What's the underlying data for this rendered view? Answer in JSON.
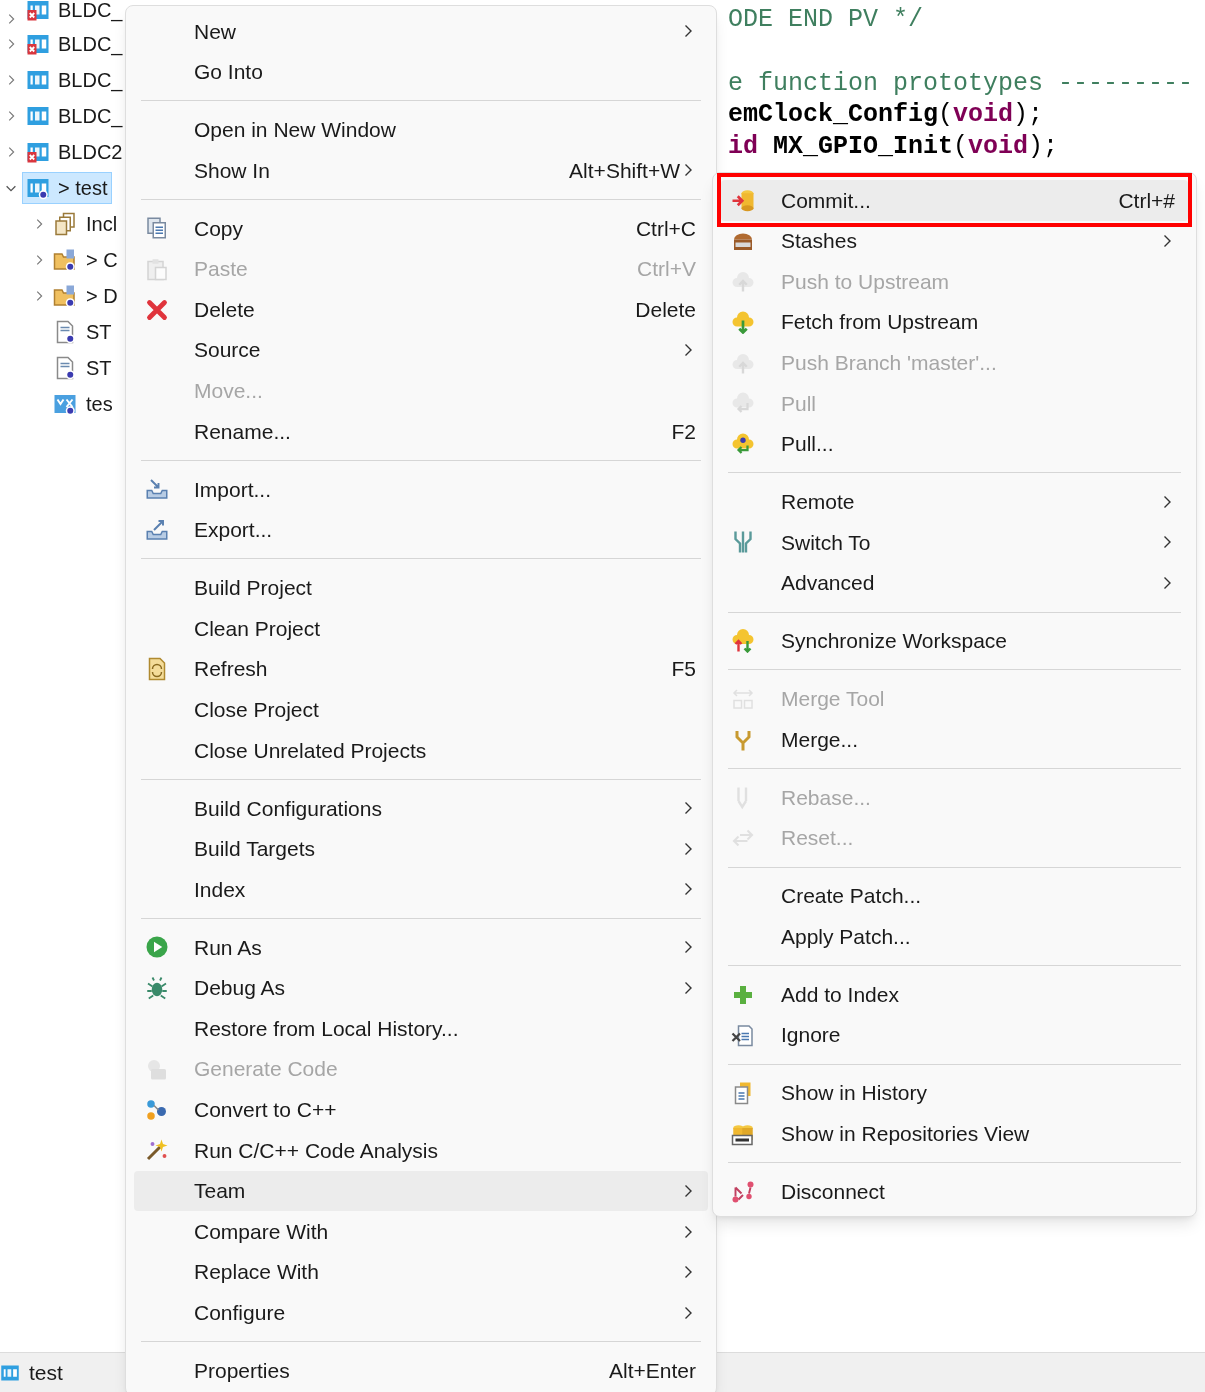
{
  "project_tree": [
    {
      "label": "BLDC_",
      "kind": "project",
      "error": true,
      "expanded": false,
      "selected": false
    },
    {
      "label": "BLDC_",
      "kind": "project",
      "error": true,
      "expanded": false,
      "selected": false
    },
    {
      "label": "BLDC_",
      "kind": "project",
      "error": false,
      "expanded": false,
      "selected": false
    },
    {
      "label": "BLDC_",
      "kind": "project",
      "error": false,
      "expanded": false,
      "selected": false
    },
    {
      "label": "BLDC2",
      "kind": "project",
      "error": true,
      "expanded": false,
      "selected": false
    },
    {
      "label": "> test",
      "kind": "project-untracked",
      "error": false,
      "expanded": true,
      "selected": true,
      "children": [
        {
          "label": "Incl",
          "kind": "includes",
          "expandable": true
        },
        {
          "label": "> C",
          "kind": "folder",
          "expandable": true
        },
        {
          "label": "> D",
          "kind": "folder",
          "expandable": true
        },
        {
          "label": "ST",
          "kind": "file",
          "expandable": false
        },
        {
          "label": "ST",
          "kind": "file",
          "expandable": false
        },
        {
          "label": "tes",
          "kind": "mx",
          "expandable": false
        }
      ]
    }
  ],
  "editor": {
    "lines": [
      {
        "segments": [
          {
            "text": "ODE END PV */",
            "kind": "comment"
          }
        ]
      },
      {
        "segments": [
          {
            "text": "e function prototypes ---------",
            "kind": "comment"
          }
        ]
      },
      {
        "segments": [
          {
            "text": "emClock_Config",
            "kind": "name"
          },
          {
            "text": "(",
            "kind": "plain"
          },
          {
            "text": "void",
            "kind": "keyword"
          },
          {
            "text": ");",
            "kind": "plain"
          }
        ]
      },
      {
        "segments": [
          {
            "text": "id",
            "kind": "keyword"
          },
          {
            "text": " MX_GPIO_Init",
            "kind": "name"
          },
          {
            "text": "(",
            "kind": "plain"
          },
          {
            "text": "void",
            "kind": "keyword"
          },
          {
            "text": ");",
            "kind": "plain"
          }
        ]
      }
    ]
  },
  "context_menu": {
    "items": [
      {
        "kind": "item",
        "label": "New",
        "submenu": true,
        "disabled": false,
        "selected": false
      },
      {
        "kind": "item",
        "label": "Go Into",
        "submenu": false,
        "disabled": false,
        "selected": false
      },
      {
        "kind": "separator"
      },
      {
        "kind": "item",
        "label": "Open in New Window",
        "submenu": false,
        "disabled": false,
        "selected": false
      },
      {
        "kind": "item",
        "label": "Show In",
        "shortcut": "Alt+Shift+W",
        "submenu": true,
        "disabled": false,
        "selected": false
      },
      {
        "kind": "separator"
      },
      {
        "kind": "item",
        "label": "Copy",
        "shortcut": "Ctrl+C",
        "submenu": false,
        "disabled": false,
        "selected": false
      },
      {
        "kind": "item",
        "label": "Paste",
        "shortcut": "Ctrl+V",
        "submenu": false,
        "disabled": true,
        "selected": false
      },
      {
        "kind": "item",
        "label": "Delete",
        "shortcut": "Delete",
        "submenu": false,
        "disabled": false,
        "selected": false
      },
      {
        "kind": "item",
        "label": "Source",
        "submenu": true,
        "disabled": false,
        "selected": false
      },
      {
        "kind": "item",
        "label": "Move...",
        "submenu": false,
        "disabled": true,
        "selected": false
      },
      {
        "kind": "item",
        "label": "Rename...",
        "shortcut": "F2",
        "submenu": false,
        "disabled": false,
        "selected": false
      },
      {
        "kind": "separator"
      },
      {
        "kind": "item",
        "label": "Import...",
        "submenu": false,
        "disabled": false,
        "selected": false
      },
      {
        "kind": "item",
        "label": "Export...",
        "submenu": false,
        "disabled": false,
        "selected": false
      },
      {
        "kind": "separator"
      },
      {
        "kind": "item",
        "label": "Build Project",
        "submenu": false,
        "disabled": false,
        "selected": false
      },
      {
        "kind": "item",
        "label": "Clean Project",
        "submenu": false,
        "disabled": false,
        "selected": false
      },
      {
        "kind": "item",
        "label": "Refresh",
        "shortcut": "F5",
        "submenu": false,
        "disabled": false,
        "selected": false
      },
      {
        "kind": "item",
        "label": "Close Project",
        "submenu": false,
        "disabled": false,
        "selected": false
      },
      {
        "kind": "item",
        "label": "Close Unrelated Projects",
        "submenu": false,
        "disabled": false,
        "selected": false
      },
      {
        "kind": "separator"
      },
      {
        "kind": "item",
        "label": "Build Configurations",
        "submenu": true,
        "disabled": false,
        "selected": false
      },
      {
        "kind": "item",
        "label": "Build Targets",
        "submenu": true,
        "disabled": false,
        "selected": false
      },
      {
        "kind": "item",
        "label": "Index",
        "submenu": true,
        "disabled": false,
        "selected": false
      },
      {
        "kind": "separator"
      },
      {
        "kind": "item",
        "label": "Run As",
        "submenu": true,
        "disabled": false,
        "selected": false
      },
      {
        "kind": "item",
        "label": "Debug As",
        "submenu": true,
        "disabled": false,
        "selected": false
      },
      {
        "kind": "item",
        "label": "Restore from Local History...",
        "submenu": false,
        "disabled": false,
        "selected": false
      },
      {
        "kind": "item",
        "label": "Generate Code",
        "submenu": false,
        "disabled": true,
        "selected": false
      },
      {
        "kind": "item",
        "label": "Convert to C++",
        "submenu": false,
        "disabled": false,
        "selected": false
      },
      {
        "kind": "item",
        "label": "Run C/C++ Code Analysis",
        "submenu": false,
        "disabled": false,
        "selected": false
      },
      {
        "kind": "item",
        "label": "Team",
        "submenu": true,
        "disabled": false,
        "selected": true
      },
      {
        "kind": "item",
        "label": "Compare With",
        "submenu": true,
        "disabled": false,
        "selected": false
      },
      {
        "kind": "item",
        "label": "Replace With",
        "submenu": true,
        "disabled": false,
        "selected": false
      },
      {
        "kind": "item",
        "label": "Configure",
        "submenu": true,
        "disabled": false,
        "selected": false
      },
      {
        "kind": "separator"
      },
      {
        "kind": "item",
        "label": "Properties",
        "shortcut": "Alt+Enter",
        "submenu": false,
        "disabled": false,
        "selected": false
      }
    ]
  },
  "team_menu": {
    "items": [
      {
        "kind": "item",
        "label": "Commit...",
        "shortcut": "Ctrl+#",
        "submenu": false,
        "disabled": false,
        "selected": true,
        "outlined": true
      },
      {
        "kind": "item",
        "label": "Stashes",
        "submenu": true,
        "disabled": false,
        "selected": false,
        "outlined": false
      },
      {
        "kind": "item",
        "label": "Push to Upstream",
        "submenu": false,
        "disabled": true,
        "selected": false,
        "outlined": false
      },
      {
        "kind": "item",
        "label": "Fetch from Upstream",
        "submenu": false,
        "disabled": false,
        "selected": false,
        "outlined": false
      },
      {
        "kind": "item",
        "label": "Push Branch 'master'...",
        "submenu": false,
        "disabled": true,
        "selected": false,
        "outlined": false
      },
      {
        "kind": "item",
        "label": "Pull",
        "submenu": false,
        "disabled": true,
        "selected": false,
        "outlined": false
      },
      {
        "kind": "item",
        "label": "Pull...",
        "submenu": false,
        "disabled": false,
        "selected": false,
        "outlined": false
      },
      {
        "kind": "separator"
      },
      {
        "kind": "item",
        "label": "Remote",
        "submenu": true,
        "disabled": false,
        "selected": false,
        "outlined": false
      },
      {
        "kind": "item",
        "label": "Switch To",
        "submenu": true,
        "disabled": false,
        "selected": false,
        "outlined": false
      },
      {
        "kind": "item",
        "label": "Advanced",
        "submenu": true,
        "disabled": false,
        "selected": false,
        "outlined": false
      },
      {
        "kind": "separator"
      },
      {
        "kind": "item",
        "label": "Synchronize Workspace",
        "submenu": false,
        "disabled": false,
        "selected": false,
        "outlined": false
      },
      {
        "kind": "separator"
      },
      {
        "kind": "item",
        "label": "Merge Tool",
        "submenu": false,
        "disabled": true,
        "selected": false,
        "outlined": false
      },
      {
        "kind": "item",
        "label": "Merge...",
        "submenu": false,
        "disabled": false,
        "selected": false,
        "outlined": false
      },
      {
        "kind": "separator"
      },
      {
        "kind": "item",
        "label": "Rebase...",
        "submenu": false,
        "disabled": true,
        "selected": false,
        "outlined": false
      },
      {
        "kind": "item",
        "label": "Reset...",
        "submenu": false,
        "disabled": true,
        "selected": false,
        "outlined": false
      },
      {
        "kind": "separator"
      },
      {
        "kind": "item",
        "label": "Create Patch...",
        "submenu": false,
        "disabled": false,
        "selected": false,
        "outlined": false
      },
      {
        "kind": "item",
        "label": "Apply Patch...",
        "submenu": false,
        "disabled": false,
        "selected": false,
        "outlined": false
      },
      {
        "kind": "separator"
      },
      {
        "kind": "item",
        "label": "Add to Index",
        "submenu": false,
        "disabled": false,
        "selected": false,
        "outlined": false
      },
      {
        "kind": "item",
        "label": "Ignore",
        "submenu": false,
        "disabled": false,
        "selected": false,
        "outlined": false
      },
      {
        "kind": "separator"
      },
      {
        "kind": "item",
        "label": "Show in History",
        "submenu": false,
        "disabled": false,
        "selected": false,
        "outlined": false
      },
      {
        "kind": "item",
        "label": "Show in Repositories View",
        "submenu": false,
        "disabled": false,
        "selected": false,
        "outlined": false
      },
      {
        "kind": "separator"
      },
      {
        "kind": "item",
        "label": "Disconnect",
        "submenu": false,
        "disabled": false,
        "selected": false,
        "outlined": false
      }
    ]
  },
  "status_bar": {
    "label": "test"
  }
}
